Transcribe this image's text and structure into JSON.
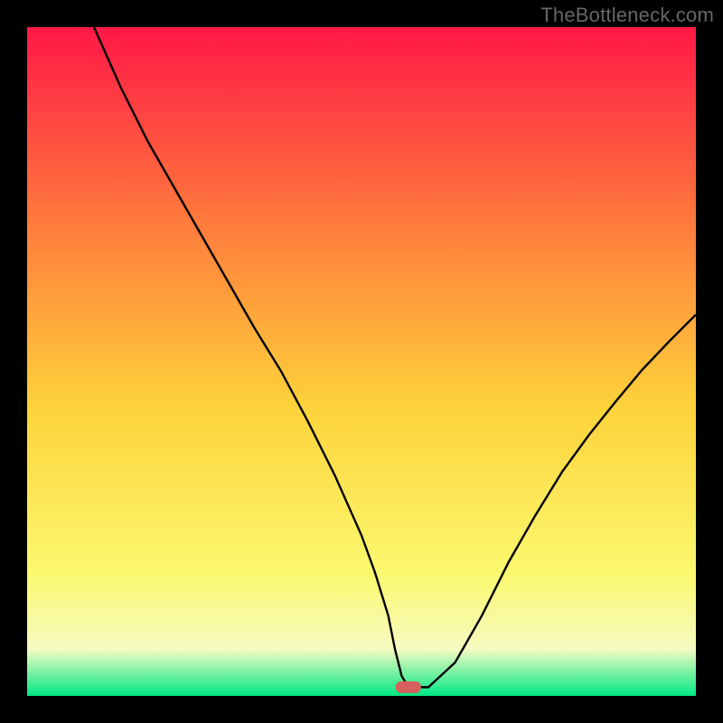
{
  "watermark": "TheBottleneck.com",
  "colors": {
    "gradient_top": "#ff1846",
    "gradient_mid_upper": "#ff7d3c",
    "gradient_mid": "#fdd33a",
    "gradient_lower": "#fbf970",
    "gradient_pale": "#f6fbc2",
    "gradient_bottom": "#00e884",
    "curve": "#000000",
    "marker": "#d6605f",
    "background": "#000000"
  },
  "chart_data": {
    "type": "line",
    "title": "",
    "xlabel": "",
    "ylabel": "",
    "xlim": [
      0,
      100
    ],
    "ylim": [
      0,
      100
    ],
    "grid": false,
    "legend": false,
    "annotations": [],
    "series": [
      {
        "name": "curve",
        "x": [
          10,
          14,
          18,
          22,
          26,
          30,
          34,
          38,
          42,
          46,
          50,
          52,
          54,
          55,
          56,
          57,
          58,
          60,
          64,
          68,
          72,
          76,
          80,
          84,
          88,
          92,
          96,
          100
        ],
        "y": [
          100,
          91,
          83,
          76,
          69,
          62,
          55,
          48.5,
          41,
          33,
          24,
          18.5,
          12,
          7,
          3,
          1.3,
          1.3,
          1.3,
          5,
          12,
          20,
          27,
          33.5,
          39,
          44,
          48.8,
          53,
          57
        ]
      }
    ],
    "marker": {
      "x": 57,
      "y": 1.3,
      "shape": "pill"
    }
  }
}
